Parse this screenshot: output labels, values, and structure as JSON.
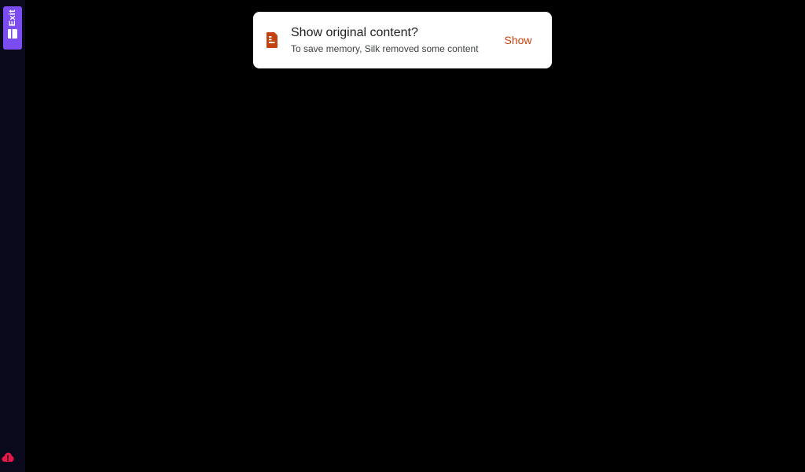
{
  "side_rail": {
    "exit_label": "Exit",
    "exit_icon": "book-exit-icon",
    "bottom_icon": "cloud-alert-icon",
    "accent_color": "#7b4cf2",
    "alert_color": "#e8174a"
  },
  "toast": {
    "icon": "document-icon",
    "title": "Show original content?",
    "subtitle": "To save memory, Silk removed some content",
    "action_label": "Show",
    "action_color": "#c4420e"
  }
}
